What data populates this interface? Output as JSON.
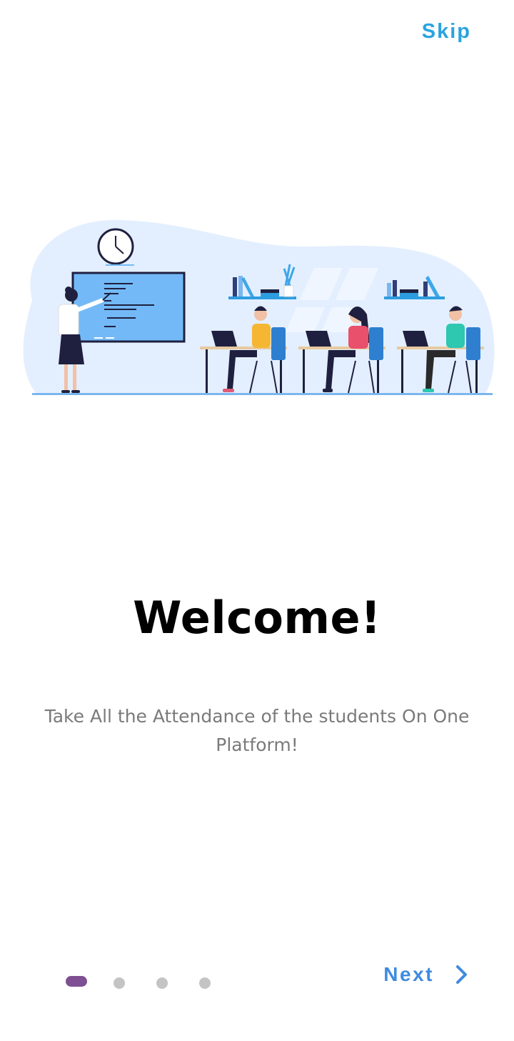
{
  "header": {
    "skip_label": "Skip"
  },
  "content": {
    "title": "Welcome!",
    "subtitle": "Take All the Attendance of the students On One Platform!"
  },
  "pager": {
    "total_pages": 4,
    "current_page": 1
  },
  "footer": {
    "next_label": "Next",
    "next_icon": "chevron-right-icon"
  },
  "illustration": {
    "name": "classroom-illustration"
  },
  "colors": {
    "skip": "#29a3e0",
    "next": "#3f8be0",
    "active_dot": "#7e4f93",
    "inactive_dot": "#c4c4c4",
    "title": "#000000",
    "subtitle": "#7a7a7a"
  }
}
